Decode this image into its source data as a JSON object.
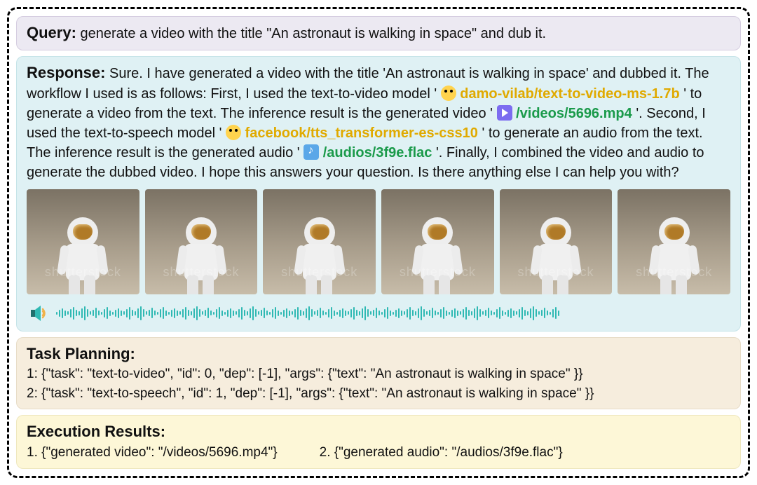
{
  "query": {
    "label": "Query:",
    "text": "generate a video with the title \"An astronaut is walking in space\" and dub it."
  },
  "response": {
    "label": "Response:",
    "intro": "Sure. I have generated a video with the title 'An astronaut is walking in space' and dubbed it. The workflow I used is as follows: First, I used the text-to-video model '",
    "model1": "damo-vilab/text-to-video-ms-1.7b",
    "afterModel1": "' to generate a video from the text. The inference result is the generated video '",
    "file1": "/videos/5696.mp4",
    "afterFile1": "'. Second, I used the text-to-speech model '",
    "model2": "facebook/tts_transformer-es-css10",
    "afterModel2": "' to generate an audio from the text. The inference result is the generated audio '",
    "file2": "/audios/3f9e.flac",
    "afterFile2": " '. Finally, I combined the video and audio to generate the dubbed video. I hope this answers your question. Is there anything else I can help you with?"
  },
  "video_frames": {
    "count": 6,
    "subject": "astronaut walking",
    "watermark": "shutterstock"
  },
  "task_planning": {
    "label": "Task Planning:",
    "items": [
      "1: {\"task\": \"text-to-video\", \"id\": 0, \"dep\": [-1], \"args\": {\"text\": \"An astronaut is walking in space\" }}",
      "2: {\"task\": \"text-to-speech\", \"id\": 1, \"dep\": [-1], \"args\": {\"text\": \"An astronaut is walking in space\" }}"
    ]
  },
  "execution_results": {
    "label": "Execution Results:",
    "items": [
      "1. {\"generated video\": \"/videos/5696.mp4\"}",
      "2. {\"generated audio\": \"/audios/3f9e.flac\"}"
    ]
  },
  "icons": {
    "hf": "hugging-face-icon",
    "video": "video-file-icon",
    "audio": "audio-file-icon",
    "speaker": "speaker-icon"
  },
  "colors": {
    "model_link": "#e0aa00",
    "file_link": "#1a9a4a",
    "wave": "#2fb9b3"
  }
}
